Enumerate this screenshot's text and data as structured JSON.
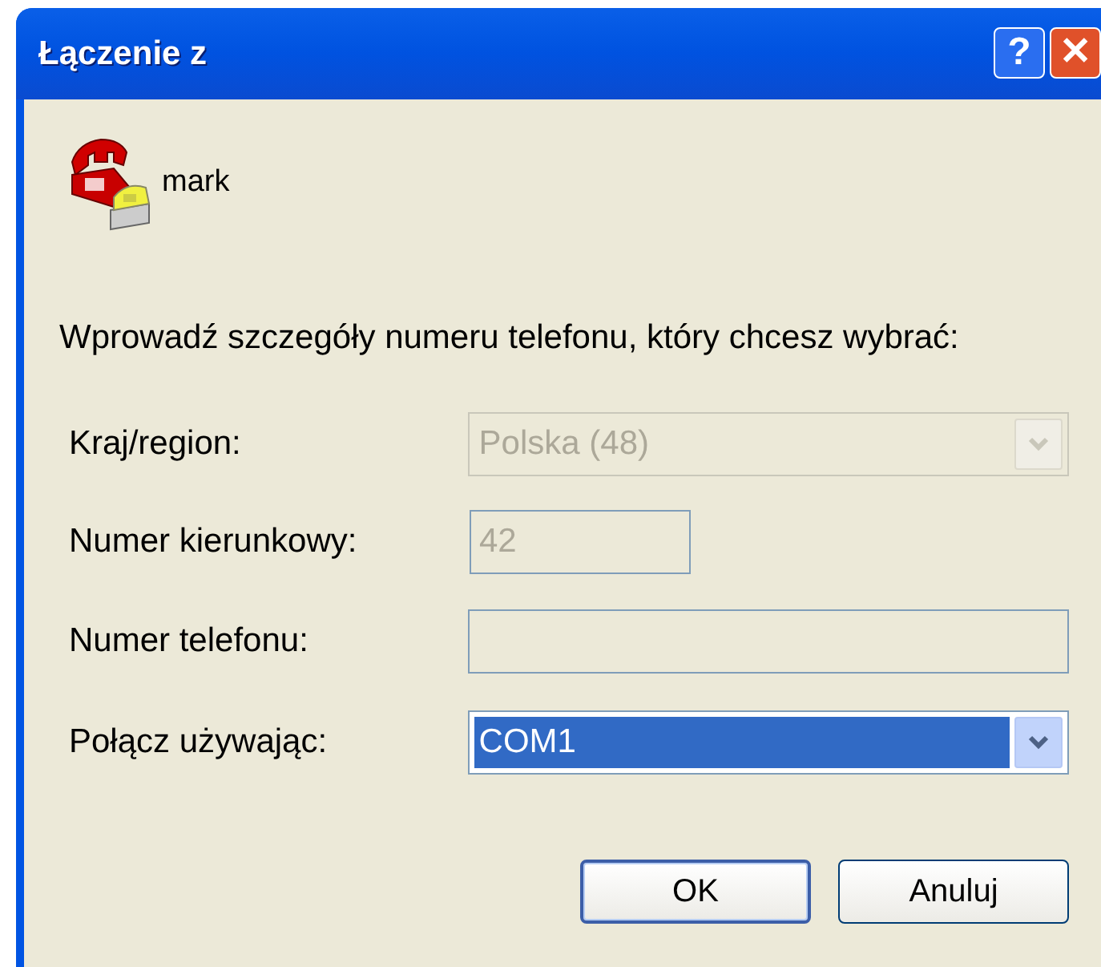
{
  "window": {
    "title": "Łączenie z",
    "buttons": [
      "?",
      "✕"
    ]
  },
  "connection": {
    "name": "mark"
  },
  "instruction": "Wprowadź szczegóły numeru telefonu, który chcesz wybrać:",
  "fields": [
    {
      "kind": "dropdown",
      "label": "Kraj/region:",
      "value": "Polska (48)",
      "disabled": true
    },
    {
      "kind": "text",
      "label": "Numer kierunkowy:",
      "value": "42",
      "disabled": true
    },
    {
      "kind": "text",
      "label": "Numer telefonu:",
      "disabled": true
    },
    {
      "kind": "dropdown",
      "label": "Połącz używając:",
      "value": "COM1",
      "disabled": false,
      "selected": true
    }
  ],
  "buttons": [
    {
      "label": "OK",
      "default": true
    },
    {
      "label": "Anuluj",
      "default": false
    }
  ]
}
